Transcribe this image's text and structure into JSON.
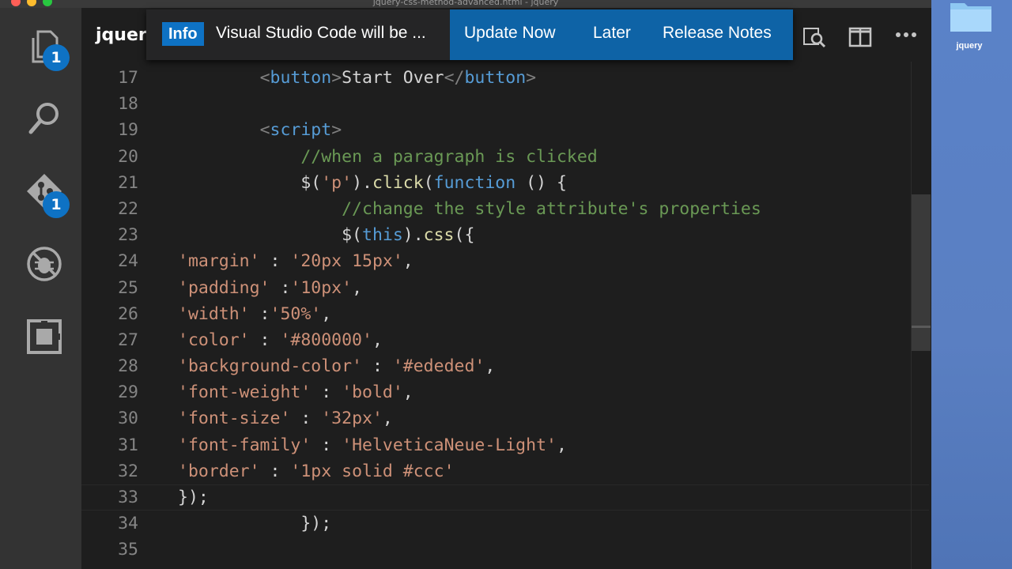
{
  "window": {
    "title": "jquery-css-method-advanced.html - jquery"
  },
  "activity_bar": {
    "items": [
      {
        "name": "explorer",
        "icon": "files-icon",
        "badge": "1"
      },
      {
        "name": "search",
        "icon": "search-icon"
      },
      {
        "name": "source-control",
        "icon": "git-icon",
        "badge": "1"
      },
      {
        "name": "debug",
        "icon": "debug-icon"
      },
      {
        "name": "extensions",
        "icon": "extensions-icon"
      }
    ]
  },
  "editor": {
    "tab_title": "jquery"
  },
  "notification": {
    "severity": "Info",
    "message": "Visual Studio Code will be ...",
    "actions": [
      "Update Now",
      "Later",
      "Release Notes"
    ]
  },
  "code_lines": [
    {
      "n": "17",
      "parts": [
        [
          "t-txt",
          "        "
        ],
        [
          "t-tag",
          "<"
        ],
        [
          "t-name",
          "button"
        ],
        [
          "t-tag",
          ">"
        ],
        [
          "t-txt",
          "Start Over"
        ],
        [
          "t-tag",
          "</"
        ],
        [
          "t-name",
          "button"
        ],
        [
          "t-tag",
          ">"
        ]
      ]
    },
    {
      "n": "18",
      "parts": []
    },
    {
      "n": "19",
      "parts": [
        [
          "t-txt",
          "        "
        ],
        [
          "t-tag",
          "<"
        ],
        [
          "t-name",
          "script"
        ],
        [
          "t-tag",
          ">"
        ]
      ]
    },
    {
      "n": "20",
      "parts": [
        [
          "t-txt",
          "            "
        ],
        [
          "t-com",
          "//when a paragraph is clicked"
        ]
      ]
    },
    {
      "n": "21",
      "parts": [
        [
          "t-txt",
          "            $("
        ],
        [
          "t-str",
          "'p'"
        ],
        [
          "t-txt",
          ")."
        ],
        [
          "t-fn",
          "click"
        ],
        [
          "t-txt",
          "("
        ],
        [
          "t-kw",
          "function"
        ],
        [
          "t-txt",
          " () {"
        ]
      ]
    },
    {
      "n": "22",
      "parts": [
        [
          "t-txt",
          "                "
        ],
        [
          "t-com",
          "//change the style attribute's properties"
        ]
      ]
    },
    {
      "n": "23",
      "parts": [
        [
          "t-txt",
          "                $("
        ],
        [
          "t-kw",
          "this"
        ],
        [
          "t-txt",
          ")."
        ],
        [
          "t-fn",
          "css"
        ],
        [
          "t-txt",
          "({"
        ]
      ]
    },
    {
      "n": "24",
      "parts": [
        [
          "t-str",
          "'margin'"
        ],
        [
          "t-txt",
          " : "
        ],
        [
          "t-str",
          "'20px 15px'"
        ],
        [
          "t-txt",
          ","
        ]
      ]
    },
    {
      "n": "25",
      "parts": [
        [
          "t-str",
          "'padding'"
        ],
        [
          "t-txt",
          " :"
        ],
        [
          "t-str",
          "'10px'"
        ],
        [
          "t-txt",
          ","
        ]
      ]
    },
    {
      "n": "26",
      "parts": [
        [
          "t-str",
          "'width'"
        ],
        [
          "t-txt",
          " :"
        ],
        [
          "t-str",
          "'50%'"
        ],
        [
          "t-txt",
          ","
        ]
      ]
    },
    {
      "n": "27",
      "parts": [
        [
          "t-str",
          "'color'"
        ],
        [
          "t-txt",
          " : "
        ],
        [
          "t-str",
          "'#800000'"
        ],
        [
          "t-txt",
          ","
        ]
      ]
    },
    {
      "n": "28",
      "parts": [
        [
          "t-str",
          "'background-color'"
        ],
        [
          "t-txt",
          " : "
        ],
        [
          "t-str",
          "'#ededed'"
        ],
        [
          "t-txt",
          ","
        ]
      ]
    },
    {
      "n": "29",
      "parts": [
        [
          "t-str",
          "'font-weight'"
        ],
        [
          "t-txt",
          " : "
        ],
        [
          "t-str",
          "'bold'"
        ],
        [
          "t-txt",
          ","
        ]
      ]
    },
    {
      "n": "30",
      "parts": [
        [
          "t-str",
          "'font-size'"
        ],
        [
          "t-txt",
          " : "
        ],
        [
          "t-str",
          "'32px'"
        ],
        [
          "t-txt",
          ","
        ]
      ]
    },
    {
      "n": "31",
      "parts": [
        [
          "t-str",
          "'font-family'"
        ],
        [
          "t-txt",
          " : "
        ],
        [
          "t-str",
          "'HelveticaNeue-Light'"
        ],
        [
          "t-txt",
          ","
        ]
      ]
    },
    {
      "n": "32",
      "parts": [
        [
          "t-str",
          "'border'"
        ],
        [
          "t-txt",
          " : "
        ],
        [
          "t-str",
          "'1px solid #ccc'"
        ]
      ]
    },
    {
      "n": "33",
      "parts": [
        [
          "t-txt",
          "});"
        ]
      ]
    },
    {
      "n": "34",
      "parts": [
        [
          "t-txt",
          "            });"
        ]
      ]
    },
    {
      "n": "35",
      "parts": []
    }
  ],
  "desktop": {
    "folder_label": "jquery"
  },
  "colors": {
    "accent": "#0e72c4",
    "notification_actions_bg": "#0e63a6",
    "editor_bg": "#1e1e1e",
    "activity_bar_bg": "#333333"
  }
}
